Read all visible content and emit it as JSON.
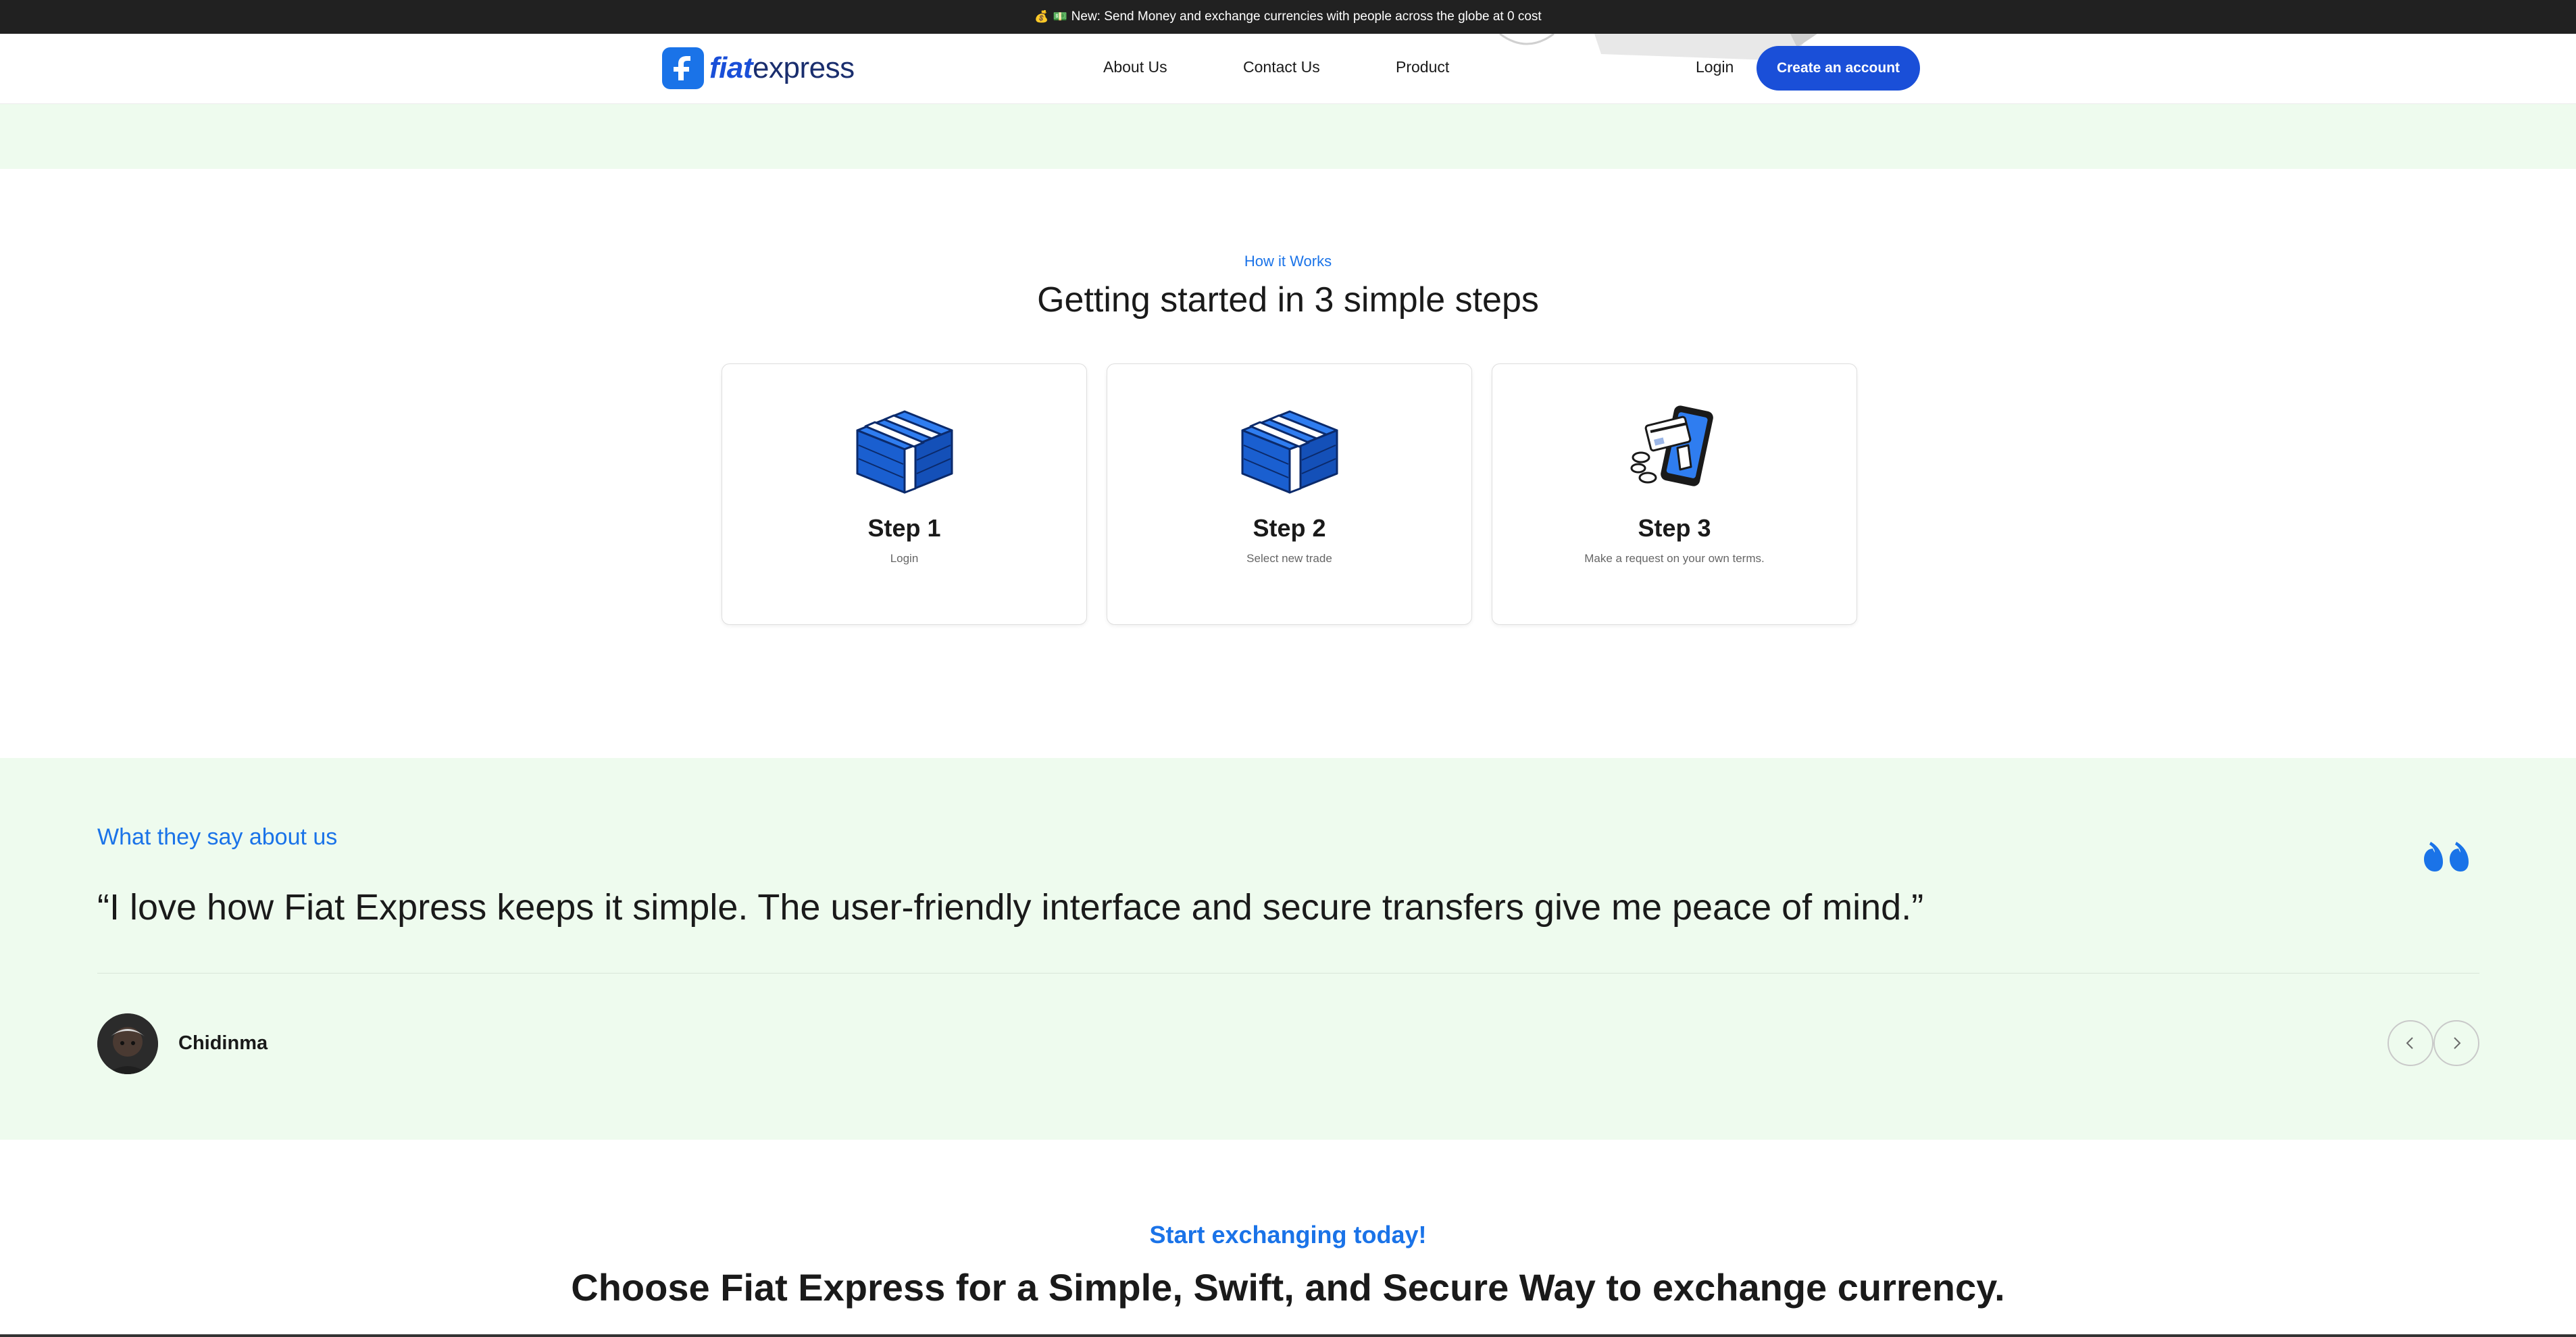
{
  "announcement": {
    "emoji_1": "💰",
    "emoji_2": "💵",
    "text": "New: Send Money and exchange currencies with people across the globe at 0 cost"
  },
  "nav": {
    "logo_bold": "fiat",
    "logo_rest": "express",
    "links": [
      "About Us",
      "Contact Us",
      "Product"
    ],
    "login": "Login",
    "cta": "Create an account"
  },
  "how_it_works": {
    "eyebrow": "How it Works",
    "title": "Getting started in 3 simple steps",
    "steps": [
      {
        "title": "Step 1",
        "subtitle": "Login",
        "icon": "money-stack-icon"
      },
      {
        "title": "Step 2",
        "subtitle": "Select new trade",
        "icon": "money-stack-icon"
      },
      {
        "title": "Step 3",
        "subtitle": "Make a request on your own terms.",
        "icon": "phone-card-icon"
      }
    ]
  },
  "testimonials": {
    "eyebrow": "What they say about us",
    "quote": "“I love how Fiat Express keeps it simple. The user-friendly interface and secure transfers give me peace of mind.”",
    "author": "Chidinma"
  },
  "cta": {
    "eyebrow": "Start exchanging today!",
    "title": "Choose Fiat Express for a Simple, Swift, and Secure Way to exchange currency."
  },
  "colors": {
    "accent": "#1a73e8",
    "button": "#1a4fd8",
    "announce_bg": "#212121",
    "section_green": "#eefbee"
  }
}
